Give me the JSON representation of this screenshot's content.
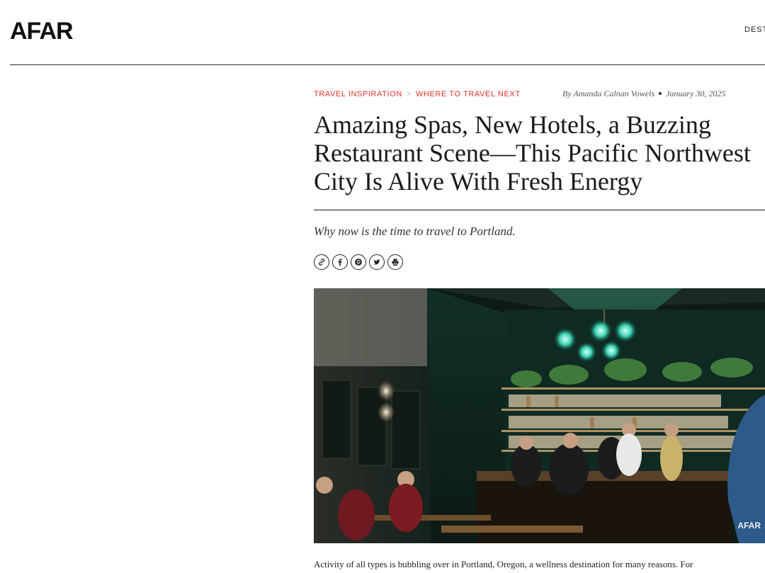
{
  "site": {
    "logo": "AFAR",
    "nav_item": "DEST"
  },
  "breadcrumb": {
    "items": [
      "TRAVEL INSPIRATION",
      "WHERE TO TRAVEL NEXT"
    ],
    "separator": ">"
  },
  "byline": {
    "author": "By Amanda Calnan Vowels",
    "date": "January 30, 2025"
  },
  "article": {
    "headline": "Amazing Spas, New Hotels, a Buzzing Restaurant Scene—This Pacific Northwest City Is Alive With Fresh Energy",
    "dek": "Why now is the time to travel to Portland.",
    "first_paragraph": "Activity of all types is bubbling over in Portland, Oregon, a wellness destination for many reasons. For"
  },
  "share_buttons": [
    {
      "icon": "link-icon"
    },
    {
      "icon": "facebook-icon"
    },
    {
      "icon": "pinterest-icon"
    },
    {
      "icon": "twitter-icon"
    },
    {
      "icon": "print-icon"
    }
  ],
  "hero_image": {
    "watermark": "AFAR"
  },
  "colors": {
    "accent": "#e0322b",
    "rule": "#1d2b2b",
    "text": "#1a1a1a"
  }
}
